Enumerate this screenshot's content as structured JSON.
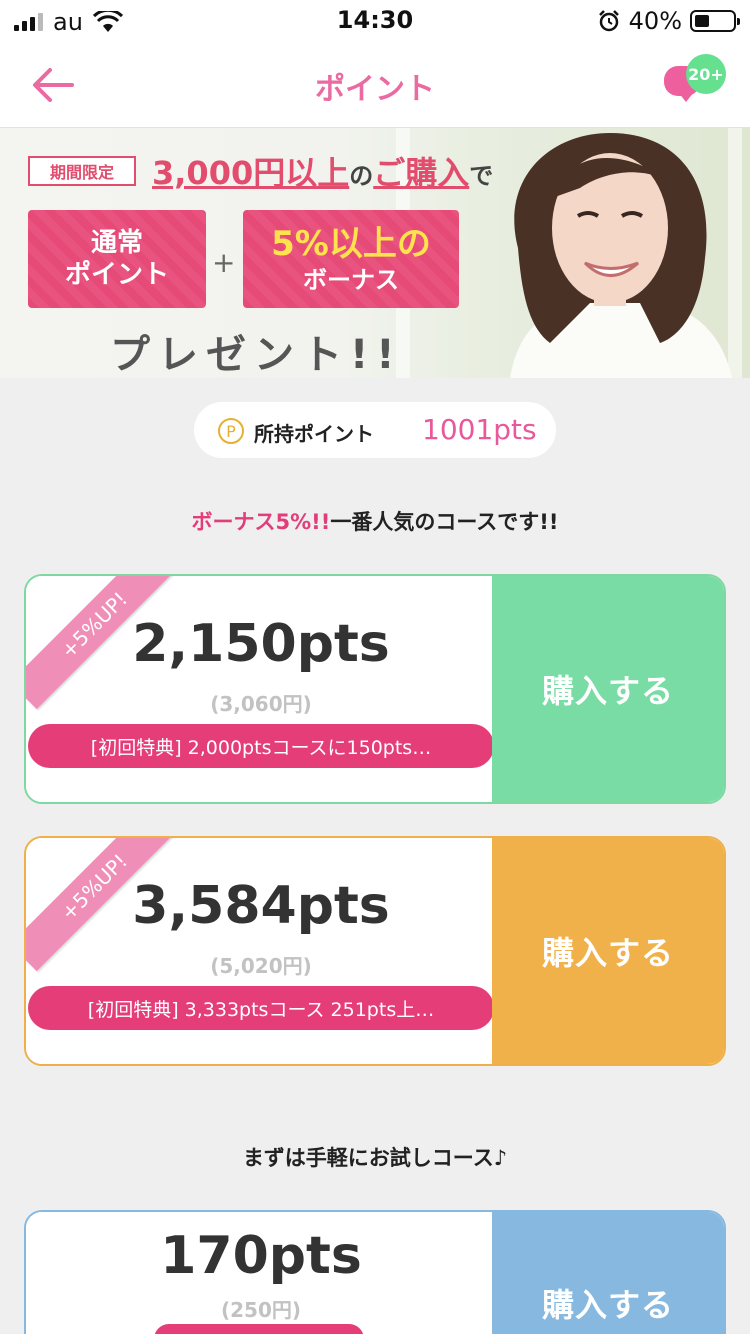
{
  "status_bar": {
    "carrier": "au",
    "time": "14:30",
    "battery": "40%",
    "battery_level": 0.4
  },
  "nav": {
    "title": "ポイント",
    "badge": "20+",
    "icons": [
      "arrow-left-icon",
      "chat-bubble-icon"
    ]
  },
  "banner": {
    "limited": "期間限定",
    "headline_amount": "3,000円以上",
    "headline_no": "の",
    "headline_purchase": "ご購入",
    "headline_de": "で",
    "box_left": "通常\nポイント",
    "plus": "+",
    "box_right_highlight": "5%以上の",
    "box_right_rest": "ボーナス",
    "present": "プレゼント!!"
  },
  "owned_points": {
    "coin_symbol": "P",
    "label": "所持ポイント",
    "value": "1001pts"
  },
  "popular_msg": {
    "highlight": "ボーナス5%!!",
    "rest": "一番人気のコースです!!"
  },
  "trial_msg": "まずは手軽にお試しコース♪",
  "courses": [
    {
      "ribbon": "+5%UP!",
      "points": "2,150pts",
      "price": "(3,060円)",
      "perk": "[初回特典] 2,000ptsコースに150pts…",
      "buy_label": "購入する",
      "color": "#79dca4"
    },
    {
      "ribbon": "+5%UP!",
      "points": "3,584pts",
      "price": "(5,020円)",
      "perk": "[初回特典] 3,333ptsコース 251pts上…",
      "buy_label": "購入する",
      "color": "#f1b14a"
    },
    {
      "points": "170pts",
      "price": "(250円)",
      "buy_label": "購入する",
      "color": "#87b9e0"
    }
  ]
}
